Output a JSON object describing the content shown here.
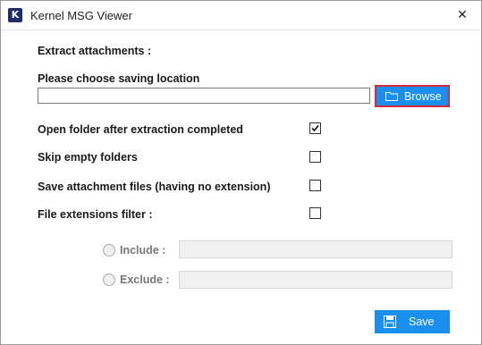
{
  "window": {
    "app_icon_letter": "K",
    "title": "Kernel MSG Viewer",
    "close_glyph": "✕"
  },
  "extract": {
    "heading": "Extract attachments :",
    "location_label": "Please choose saving location",
    "path_value": "",
    "browse_label": "Browse",
    "browse_icon": "folder-icon"
  },
  "options": [
    {
      "label": "Open folder after extraction completed",
      "checked": true
    },
    {
      "label": "Skip empty folders",
      "checked": false
    },
    {
      "label": "Save attachment files (having no extension)",
      "checked": false
    },
    {
      "label": "File extensions filter :",
      "checked": false
    }
  ],
  "filter": {
    "include_label": "Include :",
    "include_value": "",
    "exclude_label": "Exclude :",
    "exclude_value": ""
  },
  "footer": {
    "save_label": "Save",
    "save_icon": "floppy-disk-icon"
  },
  "colors": {
    "button_blue": "#1a8ff0",
    "browse_focus_border": "#d42a3c",
    "app_icon_bg": "#1e2d6b"
  }
}
